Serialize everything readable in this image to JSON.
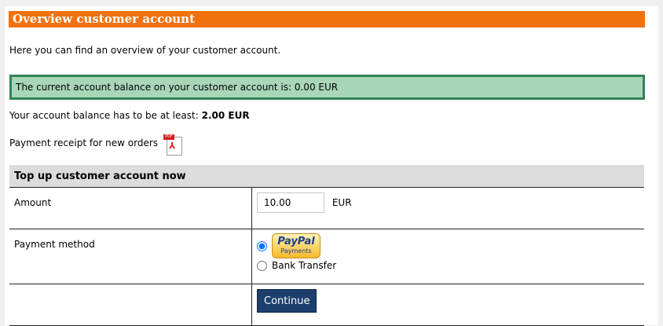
{
  "page": {
    "header_title": "Overview customer account",
    "intro": "Here you can find an overview of your customer account.",
    "balance_message": "The current account balance on your customer account is: 0.00 EUR",
    "minimum_text": "Your account balance has to be at least:",
    "minimum_value": "2.00 EUR",
    "receipt_text": "Payment receipt for new orders",
    "receipt_icon": "pdf-icon"
  },
  "topup": {
    "title": "Top up customer account now",
    "amount_label": "Amount",
    "amount_value": "10.00",
    "currency": "EUR",
    "payment_label": "Payment method",
    "paypal_text": "PayPal",
    "paypal_sub": "Payments",
    "bank_transfer": "Bank Transfer",
    "selected_method": "paypal",
    "continue_label": "Continue"
  },
  "colors": {
    "header_bg": "#ef720f",
    "balance_bg": "#a9d6b9",
    "balance_border": "#2f8558",
    "button_bg": "#1c3f6e"
  }
}
